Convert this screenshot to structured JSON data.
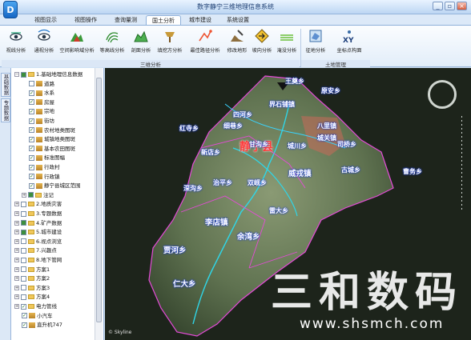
{
  "app": {
    "title": "数字静宁三维地理信息系统",
    "logo_letter": "D"
  },
  "window": {
    "minimize": "_",
    "restore": "▫",
    "close": "×"
  },
  "menu": {
    "tabs": [
      "视图显示",
      "视图操作",
      "查询量测",
      "国土分析",
      "城市建设",
      "系统设置"
    ],
    "active": "国土分析"
  },
  "ribbon": {
    "group_3d": "三维分析",
    "group_land": "土地管理",
    "buttons": [
      "视线分析",
      "通视分析",
      "空间影响域分析",
      "等高线分析",
      "剖面分析",
      "填挖方分析",
      "最佳路径分析",
      "修改地形",
      "淹没分析"
    ],
    "slope_label": "坡向分析",
    "land_buttons": [
      "征地分析",
      "坐标点构面"
    ]
  },
  "sidetabs": {
    "tab1": "基础数据",
    "tab2": "专题数据"
  },
  "tree": {
    "items": [
      {
        "label": "1.基础地理信息数据",
        "level": 0,
        "expander": "−",
        "check": "part",
        "icon": "folder"
      },
      {
        "label": "道路",
        "level": 2,
        "check": "off",
        "icon": "road"
      },
      {
        "label": "水系",
        "level": 2,
        "check": "on",
        "icon": "water"
      },
      {
        "label": "房屋",
        "level": 2,
        "check": "on",
        "icon": "layer"
      },
      {
        "label": "宗地",
        "level": 2,
        "check": "on",
        "icon": "layer"
      },
      {
        "label": "街坊",
        "level": 2,
        "check": "on",
        "icon": "layer"
      },
      {
        "label": "农村地类图斑",
        "level": 2,
        "check": "on",
        "icon": "layer"
      },
      {
        "label": "城镇地类图斑",
        "level": 2,
        "check": "on",
        "icon": "layer"
      },
      {
        "label": "基本农田图斑",
        "level": 2,
        "check": "on",
        "icon": "layer"
      },
      {
        "label": "标准图幅",
        "level": 2,
        "check": "on",
        "icon": "layer"
      },
      {
        "label": "行政村",
        "level": 2,
        "check": "on",
        "icon": "layer"
      },
      {
        "label": "行政镇",
        "level": 2,
        "check": "on",
        "icon": "layer"
      },
      {
        "label": "静宁县城区范围",
        "level": 2,
        "check": "on",
        "icon": "layer"
      },
      {
        "label": "注记",
        "level": 1,
        "expander": "+",
        "check": "part",
        "icon": "folder"
      },
      {
        "label": "2.地质灾害",
        "level": 0,
        "expander": "+",
        "check": "off",
        "icon": "folder"
      },
      {
        "label": "3.专题数据",
        "level": 0,
        "expander": "+",
        "check": "off",
        "icon": "folder"
      },
      {
        "label": "4.矿产数据",
        "level": 0,
        "expander": "+",
        "check": "part",
        "icon": "folder"
      },
      {
        "label": "5.城市建设",
        "level": 0,
        "expander": "+",
        "check": "part",
        "icon": "folder"
      },
      {
        "label": "6.视点浏览",
        "level": 0,
        "expander": "+",
        "check": "off",
        "icon": "folder"
      },
      {
        "label": "7.兴趣点",
        "level": 0,
        "expander": "+",
        "check": "off",
        "icon": "folder"
      },
      {
        "label": "8.地下管网",
        "level": 0,
        "expander": "+",
        "check": "off",
        "icon": "folder"
      },
      {
        "label": "方案1",
        "level": 0,
        "expander": "+",
        "check": "off",
        "icon": "folder"
      },
      {
        "label": "方案2",
        "level": 0,
        "expander": "+",
        "check": "off",
        "icon": "folder"
      },
      {
        "label": "方案3",
        "level": 0,
        "expander": "+",
        "check": "off",
        "icon": "folder"
      },
      {
        "label": "方案4",
        "level": 0,
        "expander": "+",
        "check": "off",
        "icon": "folder"
      },
      {
        "label": "电力管线",
        "level": 0,
        "expander": "+",
        "check": "on",
        "icon": "folder"
      },
      {
        "label": "小汽车",
        "level": 1,
        "check": "on",
        "icon": "car"
      },
      {
        "label": "直升机747",
        "level": 1,
        "check": "on",
        "icon": "plane"
      }
    ]
  },
  "map": {
    "county": "静宁县",
    "copyright": "© Skyline",
    "watermark": "三和数码",
    "watermark_url": "www.shsmch.com",
    "places": [
      "原安乡",
      "王奠乡",
      "李店镇",
      "红寺乡",
      "细巷乡",
      "城关镇",
      "贾河乡",
      "仁大乡",
      "余湾乡",
      "雷大乡",
      "双岘乡",
      "治平乡",
      "深沟乡",
      "甘沟乡",
      "威戎镇",
      "古城乡",
      "曹务乡",
      "新店乡",
      "四河乡",
      "八里镇",
      "界石铺镇",
      "司桥乡",
      "城川乡"
    ]
  }
}
